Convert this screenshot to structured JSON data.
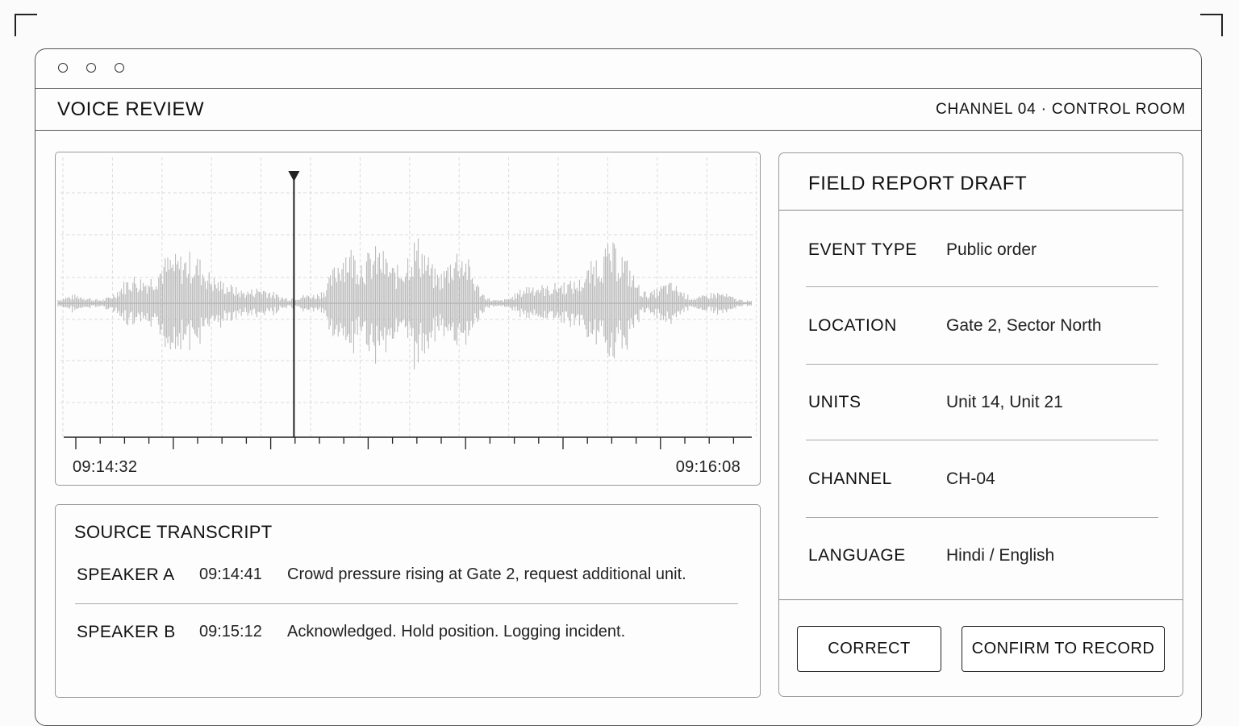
{
  "window": {
    "controls": [
      "close-dot",
      "minimize-dot",
      "maximize-dot"
    ]
  },
  "header": {
    "title": "VOICE REVIEW",
    "channel_info": "CHANNEL 04 · CONTROL ROOM"
  },
  "waveform": {
    "time_start": "09:14:32",
    "time_end": "09:16:08",
    "playhead_position": 0.34,
    "colors": {
      "wave": "#b5b5b5",
      "grid": "#dcdcdc",
      "axis": "#222222"
    }
  },
  "transcript": {
    "title": "SOURCE TRANSCRIPT",
    "rows": [
      {
        "speaker": "SPEAKER A",
        "time": "09:14:41",
        "text": "Crowd pressure rising at Gate 2, request additional unit."
      },
      {
        "speaker": "SPEAKER B",
        "time": "09:15:12",
        "text": "Acknowledged. Hold position. Logging incident."
      }
    ]
  },
  "report": {
    "title": "FIELD REPORT DRAFT",
    "fields": [
      {
        "label": "EVENT TYPE",
        "value": "Public order"
      },
      {
        "label": "LOCATION",
        "value": "Gate 2, Sector North"
      },
      {
        "label": "UNITS",
        "value": "Unit 14, Unit 21"
      },
      {
        "label": "CHANNEL",
        "value": "CH-04"
      },
      {
        "label": "LANGUAGE",
        "value": "Hindi / English"
      }
    ],
    "buttons": {
      "correct": "CORRECT",
      "confirm": "CONFIRM TO RECORD"
    }
  }
}
